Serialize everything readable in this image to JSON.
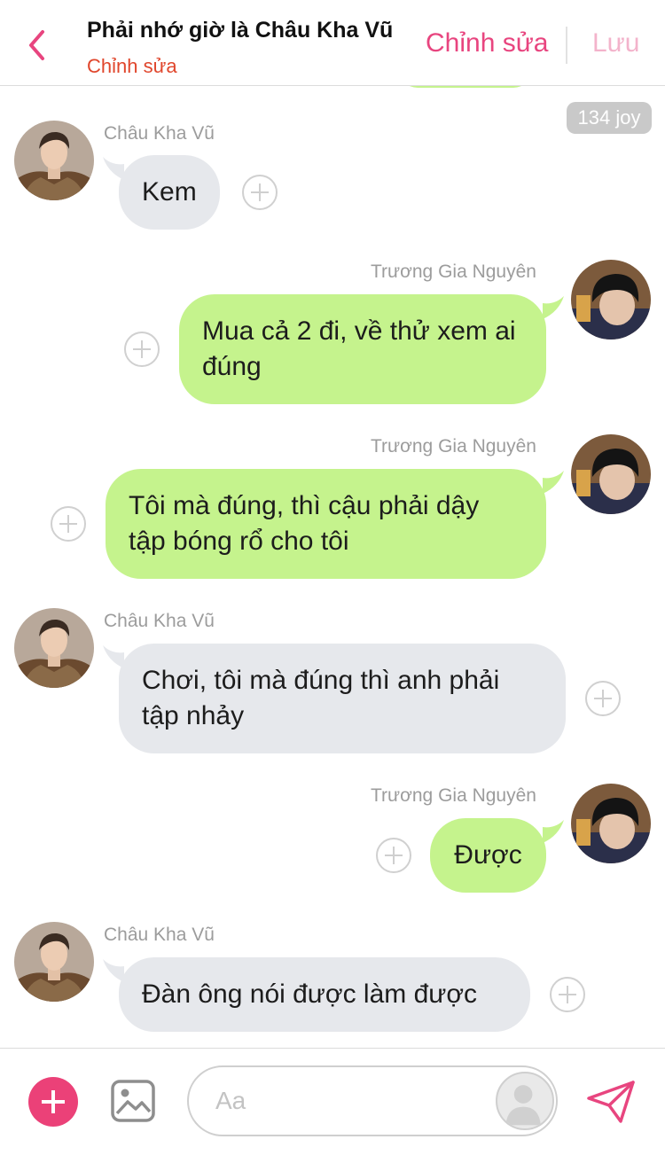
{
  "header": {
    "title": "Phải nhớ giờ là Châu Kha Vũ",
    "subtitle": "Chỉnh sửa",
    "edit_label": "Chỉnh sửa",
    "save_label": "Lưu"
  },
  "chat": {
    "joy_badge": "134 joy",
    "messages": [
      {
        "sender": "Châu Kha Vũ",
        "side": "left",
        "text": "Kem"
      },
      {
        "sender": "Trương Gia Nguyên",
        "side": "right",
        "text": "Mua cả 2 đi, về thử xem ai đúng"
      },
      {
        "sender": "Trương Gia Nguyên",
        "side": "right",
        "text": "Tôi mà đúng, thì cậu phải dậy tập bóng rổ cho tôi"
      },
      {
        "sender": "Châu Kha Vũ",
        "side": "left",
        "text": "Chơi, tôi mà đúng thì anh phải tập nhảy"
      },
      {
        "sender": "Trương Gia Nguyên",
        "side": "right",
        "text": "Được"
      },
      {
        "sender": "Châu Kha Vũ",
        "side": "left",
        "text": "Đàn ông nói được làm được"
      }
    ]
  },
  "composer": {
    "placeholder": "Aa"
  },
  "colors": {
    "accent": "#e8457f",
    "subtitle": "#e0462c",
    "bubble_left": "#e6e8ec",
    "bubble_right": "#c5f38d"
  }
}
